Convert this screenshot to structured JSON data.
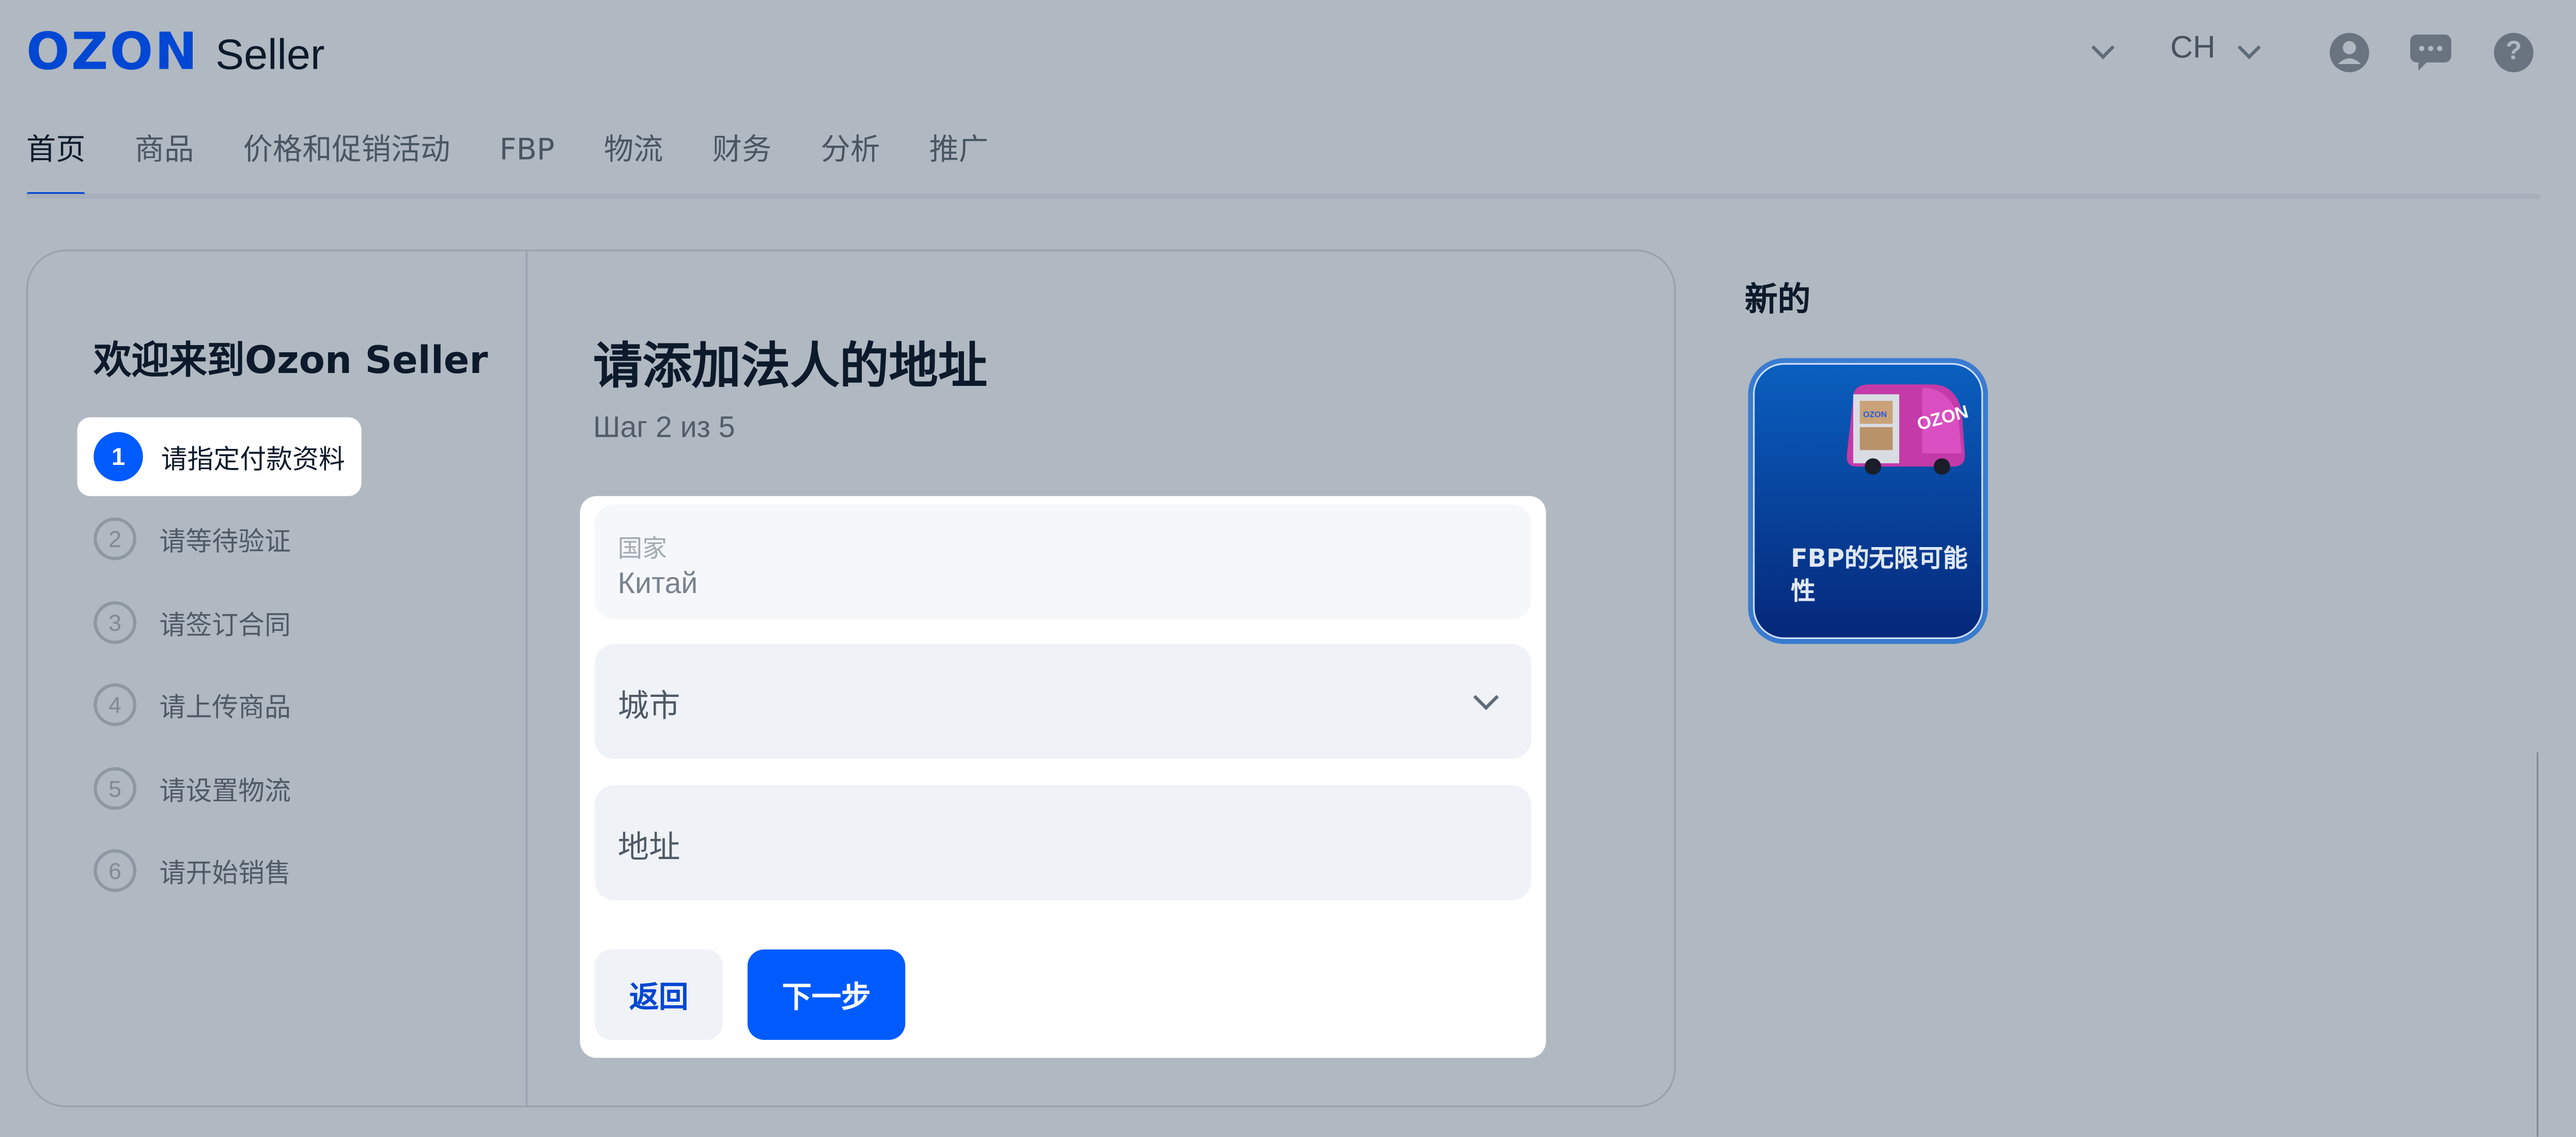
{
  "header": {
    "logo_brand": "OZON",
    "logo_product": "Seller",
    "language": "CH"
  },
  "nav": {
    "items": [
      {
        "label": "首页",
        "active": true
      },
      {
        "label": "商品"
      },
      {
        "label": "价格和促销活动"
      },
      {
        "label": "FBP"
      },
      {
        "label": "物流"
      },
      {
        "label": "财务"
      },
      {
        "label": "分析"
      },
      {
        "label": "推广"
      }
    ]
  },
  "onboarding": {
    "welcome_title": "欢迎来到Ozon Seller",
    "steps": [
      {
        "num": "1",
        "label": "请指定付款资料",
        "active": true
      },
      {
        "num": "2",
        "label": "请等待验证"
      },
      {
        "num": "3",
        "label": "请签订合同"
      },
      {
        "num": "4",
        "label": "请上传商品"
      },
      {
        "num": "5",
        "label": "请设置物流"
      },
      {
        "num": "6",
        "label": "请开始销售"
      }
    ]
  },
  "form": {
    "title": "请添加法人的地址",
    "step_text": "Шаг 2 из 5",
    "country_label": "国家",
    "country_value": "Китай",
    "city_placeholder": "城市",
    "address_placeholder": "地址",
    "back_label": "返回",
    "next_label": "下一步"
  },
  "news": {
    "title": "新的",
    "promo_text": "FBP的无限可能性",
    "van_brand": "OZON",
    "box_label": "OZON"
  },
  "colors": {
    "brand_blue": "#005bff",
    "logo_blue": "#0047d3",
    "overlay": "#b0b8c1"
  }
}
